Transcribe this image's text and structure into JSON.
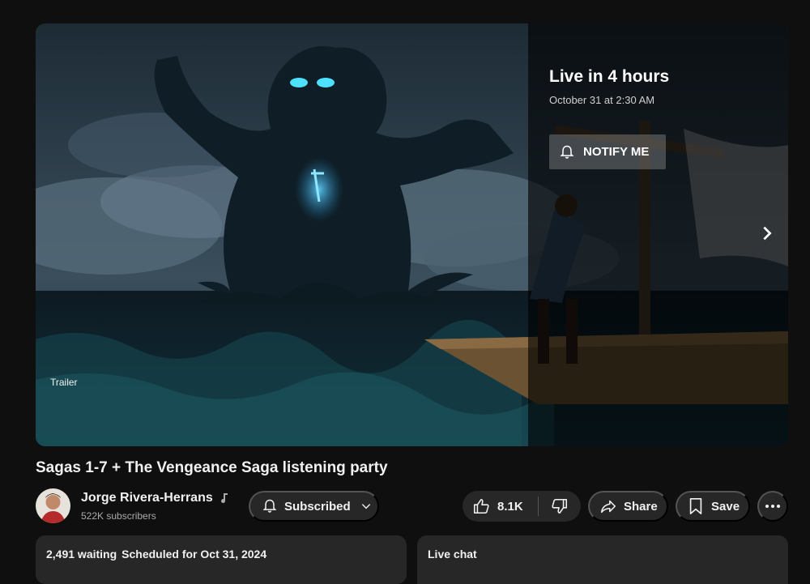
{
  "player": {
    "badge": "Trailer",
    "live_title": "Live in 4 hours",
    "live_date": "October 31 at 2:30 AM",
    "notify_label": "NOTIFY ME"
  },
  "video": {
    "title": "Sagas 1-7 + The Vengeance Saga listening party"
  },
  "channel": {
    "name": "Jorge Rivera-Herrans",
    "subscribers": "522K subscribers",
    "subscribed_label": "Subscribed"
  },
  "actions": {
    "likes": "8.1K",
    "share_label": "Share",
    "save_label": "Save"
  },
  "description": {
    "waiting": "2,491 waiting",
    "scheduled": "Scheduled for Oct 31, 2024"
  },
  "chat": {
    "title": "Live chat"
  },
  "colors": {
    "background": "#0f0f0f",
    "pill": "#272727",
    "glow": "#3fb4ff"
  }
}
